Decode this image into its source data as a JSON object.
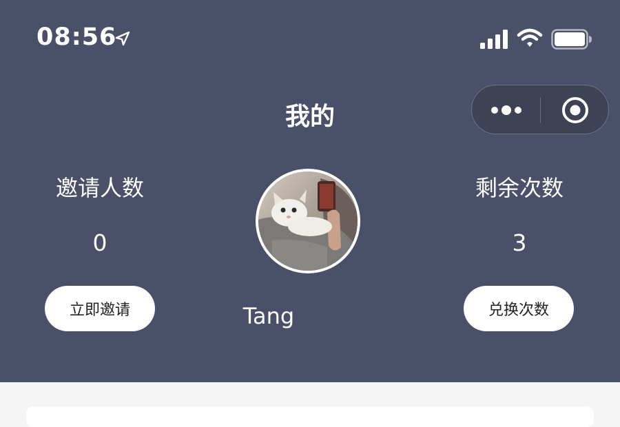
{
  "status_bar": {
    "time": "08:56",
    "icons": [
      "location-arrow-icon",
      "cellular-signal-icon",
      "wifi-icon",
      "battery-icon"
    ]
  },
  "nav": {
    "title": "我的",
    "capsule_icons": [
      "more-dots-icon",
      "target-circle-icon"
    ]
  },
  "stats": {
    "left": {
      "label": "邀请人数",
      "value": "0",
      "button": "立即邀请"
    },
    "right": {
      "label": "剩余次数",
      "value": "3",
      "button": "兑换次数"
    }
  },
  "profile": {
    "username": "Tang"
  },
  "colors": {
    "header_bg": "#4a5067",
    "page_bg": "#f5f5f5",
    "button_bg": "#ffffff",
    "text_light": "#ffffff"
  }
}
